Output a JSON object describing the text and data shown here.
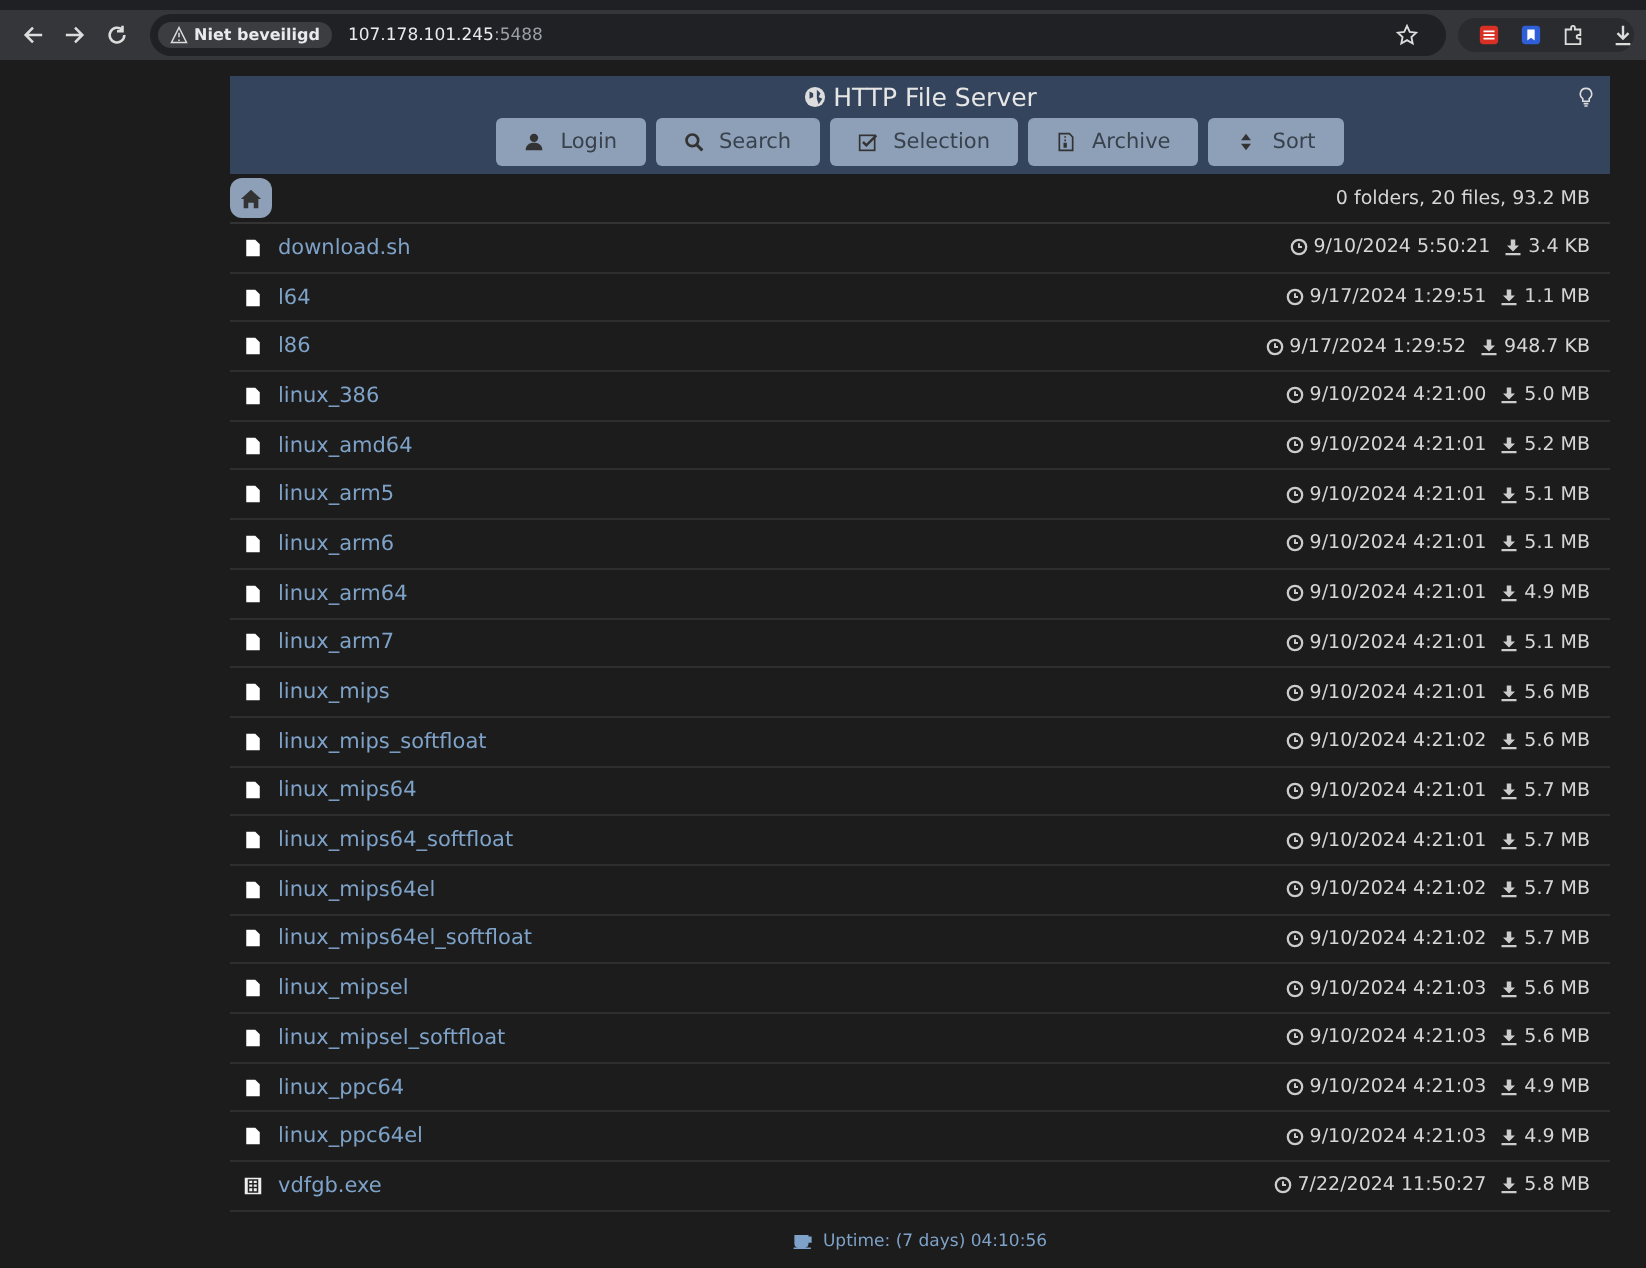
{
  "browser": {
    "security_label": "Niet beveiligd",
    "url_host": "107.178.101.245",
    "url_port": ":5488"
  },
  "header": {
    "title": "HTTP File Server",
    "buttons": [
      {
        "label": "Login",
        "kind": "user"
      },
      {
        "label": "Search",
        "kind": "search"
      },
      {
        "label": "Selection",
        "kind": "check"
      },
      {
        "label": "Archive",
        "kind": "archive"
      },
      {
        "label": "Sort",
        "kind": "sort"
      }
    ]
  },
  "summary": "0 folders, 20 files, 93.2 MB",
  "files": [
    {
      "name": "download.sh",
      "kind": "file",
      "date": "9/10/2024 5:50:21",
      "size": "3.4 KB"
    },
    {
      "name": "l64",
      "kind": "file",
      "date": "9/17/2024 1:29:51",
      "size": "1.1 MB"
    },
    {
      "name": "l86",
      "kind": "file",
      "date": "9/17/2024 1:29:52",
      "size": "948.7 KB"
    },
    {
      "name": "linux_386",
      "kind": "file",
      "date": "9/10/2024 4:21:00",
      "size": "5.0 MB"
    },
    {
      "name": "linux_amd64",
      "kind": "file",
      "date": "9/10/2024 4:21:01",
      "size": "5.2 MB"
    },
    {
      "name": "linux_arm5",
      "kind": "file",
      "date": "9/10/2024 4:21:01",
      "size": "5.1 MB"
    },
    {
      "name": "linux_arm6",
      "kind": "file",
      "date": "9/10/2024 4:21:01",
      "size": "5.1 MB"
    },
    {
      "name": "linux_arm64",
      "kind": "file",
      "date": "9/10/2024 4:21:01",
      "size": "4.9 MB"
    },
    {
      "name": "linux_arm7",
      "kind": "file",
      "date": "9/10/2024 4:21:01",
      "size": "5.1 MB"
    },
    {
      "name": "linux_mips",
      "kind": "file",
      "date": "9/10/2024 4:21:01",
      "size": "5.6 MB"
    },
    {
      "name": "linux_mips_softfloat",
      "kind": "file",
      "date": "9/10/2024 4:21:02",
      "size": "5.6 MB"
    },
    {
      "name": "linux_mips64",
      "kind": "file",
      "date": "9/10/2024 4:21:01",
      "size": "5.7 MB"
    },
    {
      "name": "linux_mips64_softfloat",
      "kind": "file",
      "date": "9/10/2024 4:21:01",
      "size": "5.7 MB"
    },
    {
      "name": "linux_mips64el",
      "kind": "file",
      "date": "9/10/2024 4:21:02",
      "size": "5.7 MB"
    },
    {
      "name": "linux_mips64el_softfloat",
      "kind": "file",
      "date": "9/10/2024 4:21:02",
      "size": "5.7 MB"
    },
    {
      "name": "linux_mipsel",
      "kind": "file",
      "date": "9/10/2024 4:21:03",
      "size": "5.6 MB"
    },
    {
      "name": "linux_mipsel_softfloat",
      "kind": "file",
      "date": "9/10/2024 4:21:03",
      "size": "5.6 MB"
    },
    {
      "name": "linux_ppc64",
      "kind": "file",
      "date": "9/10/2024 4:21:03",
      "size": "4.9 MB"
    },
    {
      "name": "linux_ppc64el",
      "kind": "file",
      "date": "9/10/2024 4:21:03",
      "size": "4.9 MB"
    },
    {
      "name": "vdfgb.exe",
      "kind": "exe",
      "date": "7/22/2024 11:50:27",
      "size": "5.8 MB"
    }
  ],
  "footer": {
    "uptime": "Uptime: (7 days) 04:10:56"
  }
}
